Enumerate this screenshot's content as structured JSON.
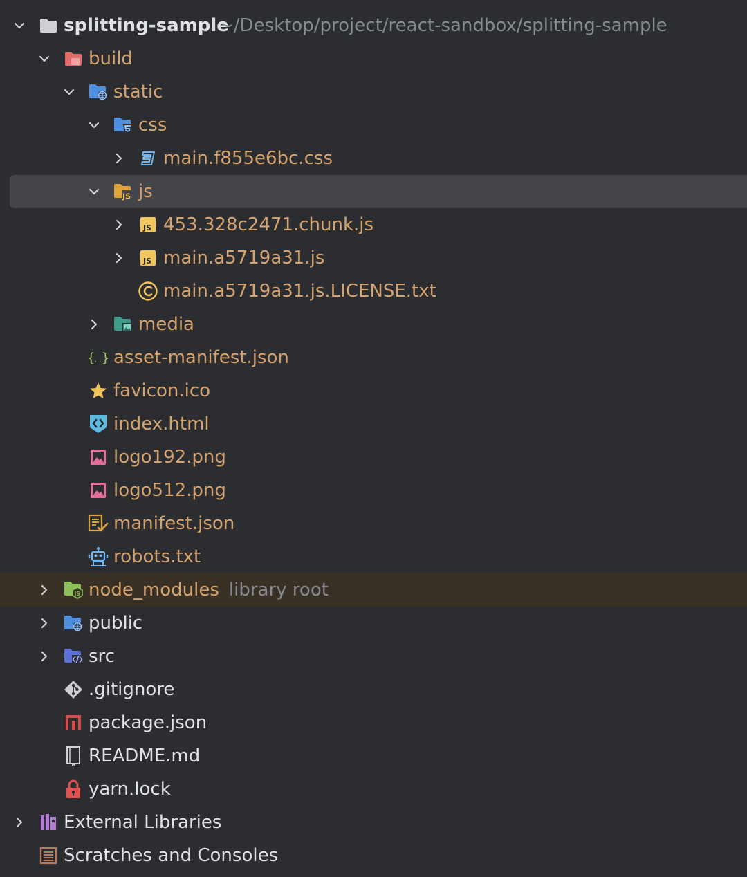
{
  "project": {
    "name": "splitting-sample",
    "path": "~/Desktop/project/react-sandbox/splitting-sample"
  },
  "tree": {
    "build": "build",
    "static": "static",
    "css": "css",
    "css_file": "main.f855e6bc.css",
    "js": "js",
    "js_chunk": "453.328c2471.chunk.js",
    "js_main": "main.a5719a31.js",
    "js_license": "main.a5719a31.js.LICENSE.txt",
    "media": "media",
    "asset_manifest": "asset-manifest.json",
    "favicon": "favicon.ico",
    "index_html": "index.html",
    "logo192": "logo192.png",
    "logo512": "logo512.png",
    "manifest": "manifest.json",
    "robots": "robots.txt",
    "node_modules": "node_modules",
    "node_modules_hint": "library root",
    "public": "public",
    "src": "src",
    "gitignore": ".gitignore",
    "package_json": "package.json",
    "readme": "README.md",
    "yarn_lock": "yarn.lock",
    "external_libraries": "External Libraries",
    "scratches": "Scratches and Consoles"
  },
  "icons": {
    "folder": "folder-icon",
    "build-folder": "excluded-folder-icon",
    "web-folder": "web-folder-icon",
    "css-folder": "css-folder-icon",
    "js-folder": "js-folder-icon",
    "media-folder": "media-folder-icon",
    "css-file": "css-file-icon",
    "js-file": "js-file-icon",
    "license": "copyright-icon",
    "json": "json-braces-icon",
    "star": "star-icon",
    "html": "html-file-icon",
    "image": "image-file-icon",
    "manifest": "manifest-file-icon",
    "robot": "robot-icon",
    "node-folder": "node-modules-folder-icon",
    "src-folder": "source-folder-icon",
    "git": "git-icon",
    "npm": "npm-icon",
    "readme": "readme-icon",
    "lock": "lock-icon",
    "library": "library-icon",
    "scratches": "scratches-icon"
  },
  "colors": {
    "background": "#2b2d30",
    "selected_row": "#43454a",
    "library_row": "#3a3126",
    "excluded_text": "#d5a36f",
    "normal_text": "#dfe1e5",
    "hint_text": "#868a91"
  }
}
